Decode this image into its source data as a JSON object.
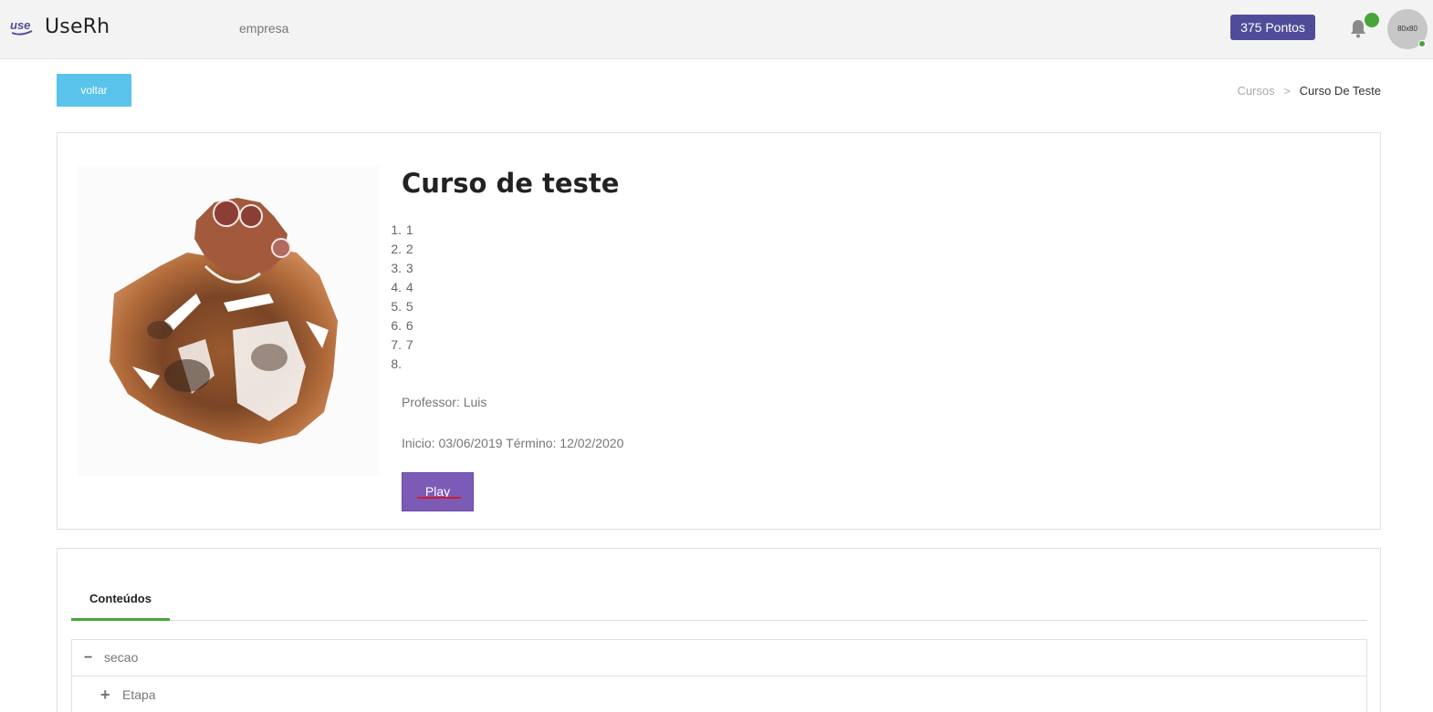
{
  "header": {
    "logo_mark": "use",
    "logo_text": "UseRh",
    "company": "empresa",
    "points_label": "375 Pontos",
    "avatar_label": "80x80"
  },
  "nav": {
    "back_label": "voltar",
    "breadcrumb": [
      "Cursos",
      "Curso De Teste"
    ],
    "breadcrumb_separator": ">"
  },
  "course": {
    "title": "Curso de teste",
    "topics": [
      {
        "num": "1.",
        "text": "1"
      },
      {
        "num": "2.",
        "text": "2"
      },
      {
        "num": "3.",
        "text": "3"
      },
      {
        "num": "4.",
        "text": "4"
      },
      {
        "num": "5.",
        "text": "5"
      },
      {
        "num": "6.",
        "text": "6"
      },
      {
        "num": "7.",
        "text": "7"
      },
      {
        "num": "8.",
        "text": ""
      }
    ],
    "professor": "Professor: Luis",
    "dates": "Inicio: 03/06/2019 Término: 12/02/2020",
    "play_label": "Play"
  },
  "contents": {
    "tab_label": "Conteúdos",
    "section": {
      "toggle": "−",
      "label": "secao"
    },
    "step": {
      "toggle": "+",
      "label": "Etapa"
    }
  },
  "colors": {
    "points_bg": "#514c99",
    "back_bg": "#59c3ec",
    "play_bg": "#7c5bb7",
    "accent_green": "#47a53a"
  },
  "icons": {
    "bell": "bell-icon",
    "logo": "use-logo-icon"
  }
}
